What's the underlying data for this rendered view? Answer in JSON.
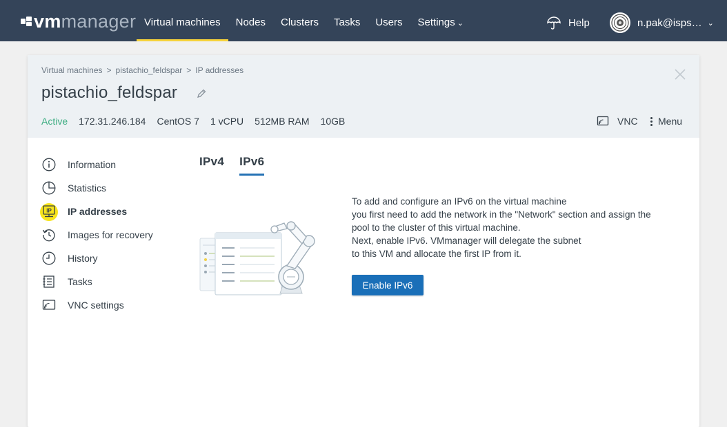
{
  "app": {
    "logo_text_bold": "vm",
    "logo_text_rest": "manager"
  },
  "nav": {
    "items": [
      {
        "label": "Virtual machines",
        "active": true
      },
      {
        "label": "Nodes"
      },
      {
        "label": "Clusters"
      },
      {
        "label": "Tasks"
      },
      {
        "label": "Users"
      },
      {
        "label": "Settings"
      }
    ],
    "help_label": "Help",
    "user_name": "n.pak@isps…",
    "accent_color": "#f7d33b",
    "bar_color": "#344459"
  },
  "breadcrumb": [
    "Virtual machines",
    "pistachio_feldspar",
    "IP addresses"
  ],
  "vm": {
    "name": "pistachio_feldspar",
    "status": "Active",
    "ip": "172.31.246.184",
    "os": "CentOS 7",
    "cpu": "1 vCPU",
    "ram": "512MB RAM",
    "disk": "10GB",
    "vnc_label": "VNC",
    "menu_label": "Menu"
  },
  "sidebar": {
    "items": [
      {
        "label": "Information",
        "icon": "info-icon"
      },
      {
        "label": "Statistics",
        "icon": "pie-chart-icon"
      },
      {
        "label": "IP addresses",
        "icon": "ip-address-icon",
        "active": true
      },
      {
        "label": "Images for recovery",
        "icon": "restore-icon"
      },
      {
        "label": "History",
        "icon": "clock-icon"
      },
      {
        "label": "Tasks",
        "icon": "tasks-list-icon"
      },
      {
        "label": "VNC settings",
        "icon": "vnc-icon"
      }
    ]
  },
  "tabs": [
    {
      "label": "IPv4"
    },
    {
      "label": "IPv6",
      "active": true
    }
  ],
  "empty_state": {
    "lines": [
      "To add and configure an IPv6 on the virtual machine",
      "you first need to add the network in the \"Network\" section and assign the",
      "pool to the cluster of this virtual machine.",
      "Next, enable IPv6. VMmanager will delegate the subnet",
      "to this VM and allocate the first IP from it."
    ],
    "button_label": "Enable IPv6"
  },
  "colors": {
    "status_active": "#3fae83",
    "primary_button": "#1a6fb8",
    "tab_underline": "#2572b5",
    "active_icon_highlight": "#f7e41d"
  }
}
